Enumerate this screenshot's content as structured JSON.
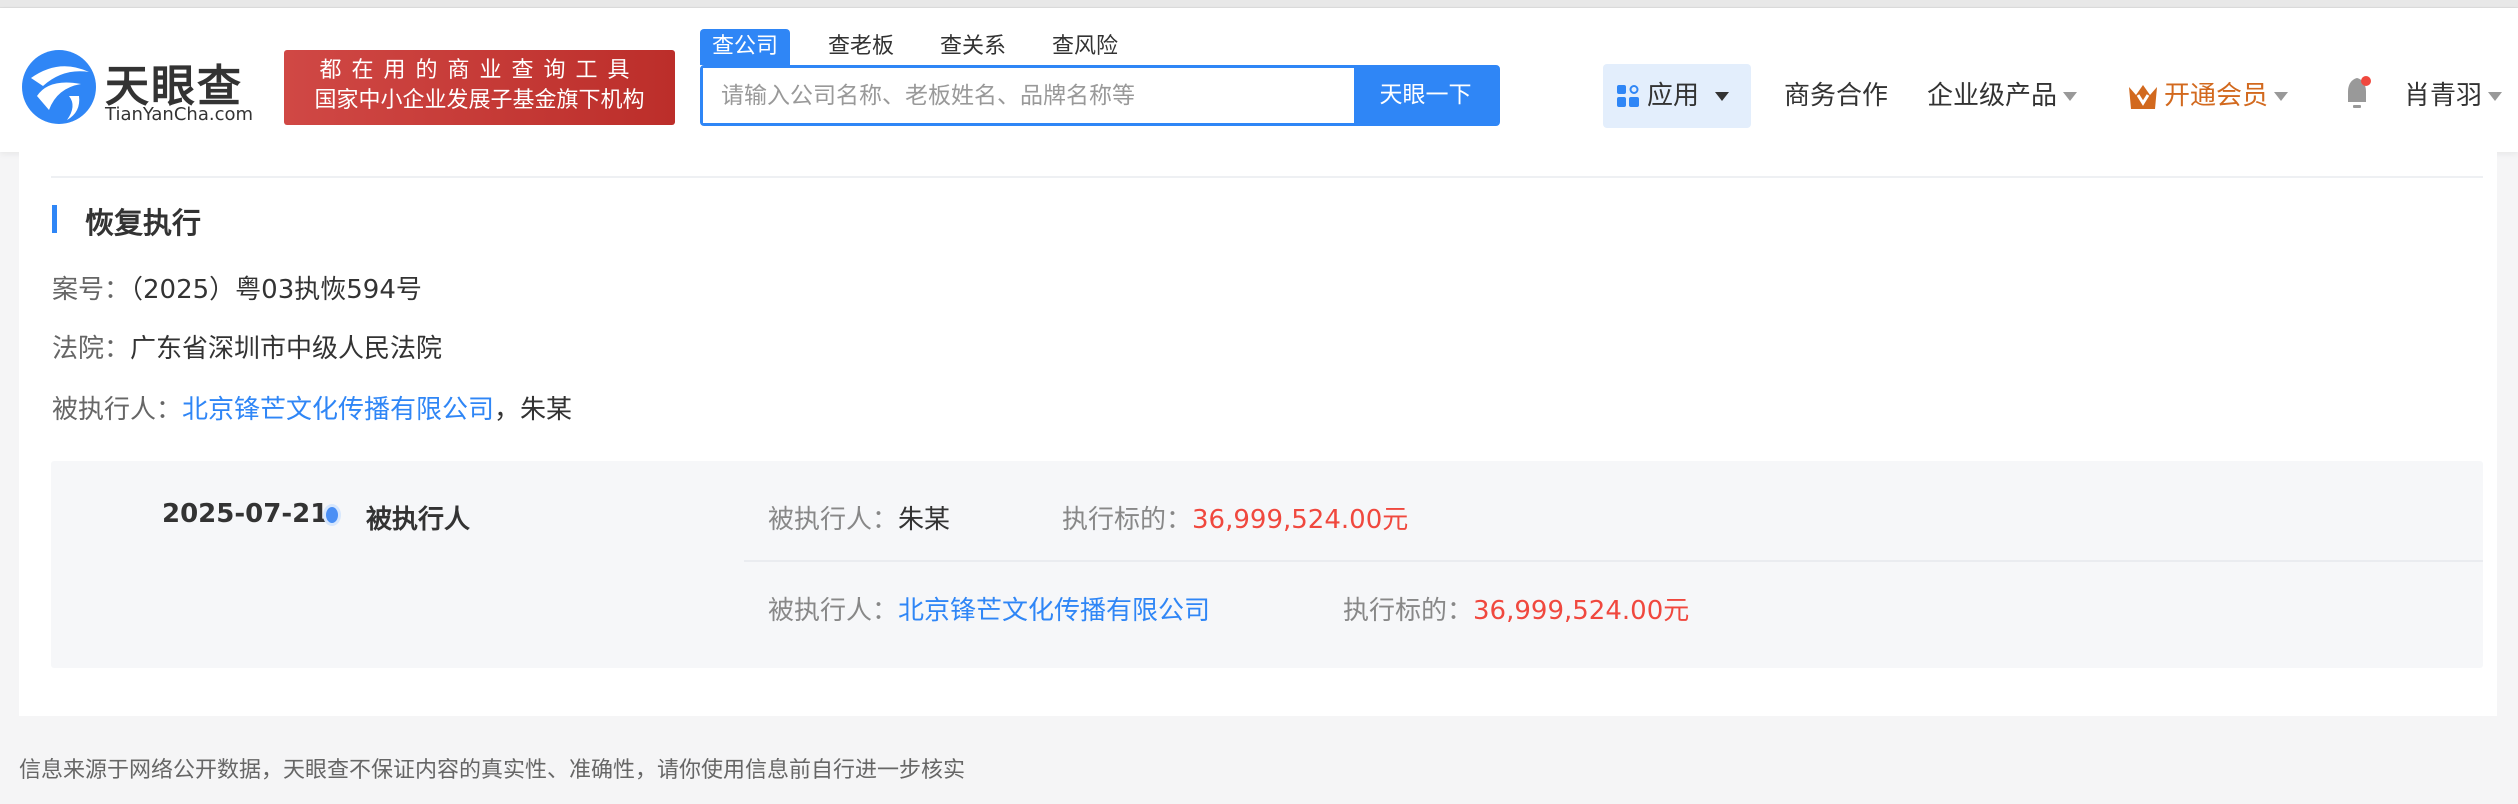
{
  "header": {
    "logo_text": "天眼查",
    "logo_sub": "TianYanCha.com",
    "banner_line1": "都在用的商业查询工具",
    "banner_line2": "国家中小企业发展子基金旗下机构",
    "search_tabs": [
      "查公司",
      "查老板",
      "查关系",
      "查风险"
    ],
    "search_placeholder": "请输入公司名称、老板姓名、品牌名称等",
    "search_button": "天眼一下",
    "nav": {
      "apps": "应用",
      "business": "商务合作",
      "enterprise": "企业级产品",
      "vip": "开通会员",
      "user": "肖青羽"
    }
  },
  "section": {
    "title": "恢复执行",
    "case_label": "案号：",
    "case_no": "（2025）粤03执恢594号",
    "court_label": "法院：",
    "court": "广东省深圳市中级人民法院",
    "party_label": "被执行人：",
    "party_company": "北京锋芒文化传播有限公司",
    "party_sep": "，",
    "party_person": "朱某"
  },
  "timeline": {
    "date": "2025-07-21",
    "type": "被执行人",
    "rows": [
      {
        "party_label": "被执行人：",
        "party": "朱某",
        "amount_label": "执行标的：",
        "amount": "36,999,524.00元"
      },
      {
        "party_label": "被执行人：",
        "party": "北京锋芒文化传播有限公司",
        "amount_label": "执行标的：",
        "amount": "36,999,524.00元"
      }
    ]
  },
  "footer": "信息来源于网络公开数据，天眼查不保证内容的真实性、准确性，请你使用信息前自行进一步核实",
  "colors": {
    "brand": "#2f86f6",
    "amount": "#f0483e",
    "vip": "#d2691e",
    "banner": "#c8393a"
  }
}
